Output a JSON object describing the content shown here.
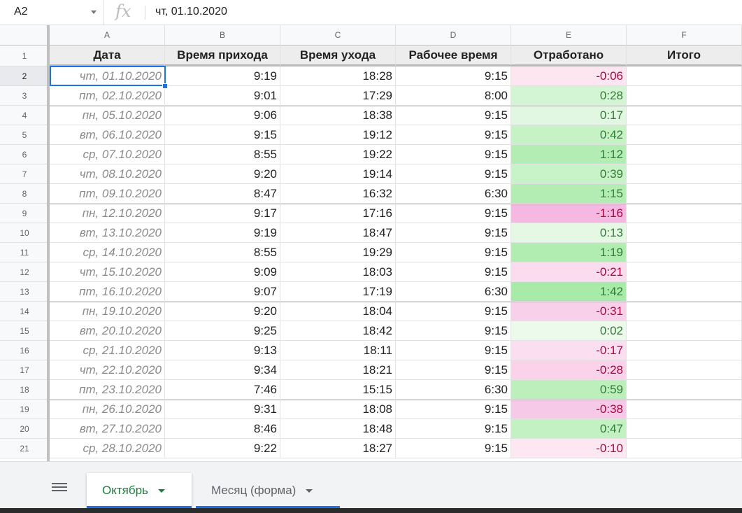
{
  "formula_bar": {
    "cell_ref": "A2",
    "fx_label": "fx",
    "value": "чт, 01.10.2020"
  },
  "columns": [
    "A",
    "B",
    "C",
    "D",
    "E",
    "F"
  ],
  "headers": [
    "Дата",
    "Время прихода",
    "Время ухода",
    "Рабочее время",
    "Отработано",
    "Итого"
  ],
  "header_row_number": "1",
  "rows": [
    {
      "n": "2",
      "date": "чт, 01.10.2020",
      "in": "9:19",
      "out": "18:28",
      "work": "9:15",
      "done": "-0:06",
      "sign": "neg",
      "shade": "#fde6ef",
      "week": false
    },
    {
      "n": "3",
      "date": "пт, 02.10.2020",
      "in": "9:01",
      "out": "17:29",
      "work": "8:00",
      "done": "0:28",
      "sign": "pos",
      "shade": "#d3f5d3",
      "week": false
    },
    {
      "n": "4",
      "date": "пн, 05.10.2020",
      "in": "9:06",
      "out": "18:38",
      "work": "9:15",
      "done": "0:17",
      "sign": "pos",
      "shade": "#e1f7e1",
      "week": true
    },
    {
      "n": "5",
      "date": "вт, 06.10.2020",
      "in": "9:15",
      "out": "19:12",
      "work": "9:15",
      "done": "0:42",
      "sign": "pos",
      "shade": "#c6f2c6",
      "week": false
    },
    {
      "n": "6",
      "date": "ср, 07.10.2020",
      "in": "8:55",
      "out": "19:22",
      "work": "9:15",
      "done": "1:12",
      "sign": "pos",
      "shade": "#b4edb4",
      "week": false
    },
    {
      "n": "7",
      "date": "чт, 08.10.2020",
      "in": "9:20",
      "out": "19:14",
      "work": "9:15",
      "done": "0:39",
      "sign": "pos",
      "shade": "#c8f2c8",
      "week": false
    },
    {
      "n": "8",
      "date": "пт, 09.10.2020",
      "in": "8:47",
      "out": "16:32",
      "work": "6:30",
      "done": "1:15",
      "sign": "pos",
      "shade": "#b3edb3",
      "week": false
    },
    {
      "n": "9",
      "date": "пн, 12.10.2020",
      "in": "9:17",
      "out": "17:16",
      "work": "9:15",
      "done": "-1:16",
      "sign": "neg",
      "shade": "#f5b8e1",
      "week": true
    },
    {
      "n": "10",
      "date": "вт, 13.10.2020",
      "in": "9:19",
      "out": "18:47",
      "work": "9:15",
      "done": "0:13",
      "sign": "pos",
      "shade": "#e4f8e4",
      "week": false
    },
    {
      "n": "11",
      "date": "ср, 14.10.2020",
      "in": "8:55",
      "out": "19:29",
      "work": "9:15",
      "done": "1:19",
      "sign": "pos",
      "shade": "#b1ecb1",
      "week": false
    },
    {
      "n": "12",
      "date": "чт, 15.10.2020",
      "in": "9:09",
      "out": "18:03",
      "work": "9:15",
      "done": "-0:21",
      "sign": "neg",
      "shade": "#fbdcee",
      "week": false
    },
    {
      "n": "13",
      "date": "пт, 16.10.2020",
      "in": "9:07",
      "out": "17:19",
      "work": "6:30",
      "done": "1:42",
      "sign": "pos",
      "shade": "#a8eaa8",
      "week": false
    },
    {
      "n": "14",
      "date": "пн, 19.10.2020",
      "in": "9:20",
      "out": "18:04",
      "work": "9:15",
      "done": "-0:31",
      "sign": "neg",
      "shade": "#f9d0ea",
      "week": true
    },
    {
      "n": "15",
      "date": "вт, 20.10.2020",
      "in": "9:25",
      "out": "18:42",
      "work": "9:15",
      "done": "0:02",
      "sign": "pos",
      "shade": "#ebfaeb",
      "week": false
    },
    {
      "n": "16",
      "date": "ср, 21.10.2020",
      "in": "9:13",
      "out": "18:11",
      "work": "9:15",
      "done": "-0:17",
      "sign": "neg",
      "shade": "#fbdff0",
      "week": false
    },
    {
      "n": "17",
      "date": "чт, 22.10.2020",
      "in": "9:34",
      "out": "18:21",
      "work": "9:15",
      "done": "-0:28",
      "sign": "neg",
      "shade": "#fad3eb",
      "week": false
    },
    {
      "n": "18",
      "date": "пт, 23.10.2020",
      "in": "7:46",
      "out": "15:15",
      "work": "6:30",
      "done": "0:59",
      "sign": "pos",
      "shade": "#bdefbd",
      "week": false
    },
    {
      "n": "19",
      "date": "пн, 26.10.2020",
      "in": "9:31",
      "out": "18:08",
      "work": "9:15",
      "done": "-0:38",
      "sign": "neg",
      "shade": "#f7c9e8",
      "week": true
    },
    {
      "n": "20",
      "date": "вт, 27.10.2020",
      "in": "8:46",
      "out": "18:48",
      "work": "9:15",
      "done": "0:47",
      "sign": "pos",
      "shade": "#c3f1c3",
      "week": false
    },
    {
      "n": "21",
      "date": "ср, 28.10.2020",
      "in": "9:22",
      "out": "18:27",
      "work": "9:15",
      "done": "-0:10",
      "sign": "neg",
      "shade": "#fde8f1",
      "week": false
    }
  ],
  "tabs": {
    "menu_icon": "list-icon",
    "active_label": "Октябрь",
    "inactive_label": "Месяц (форма)"
  },
  "colors": {
    "selection": "#1a73e8",
    "active_tab_text": "#188038"
  }
}
